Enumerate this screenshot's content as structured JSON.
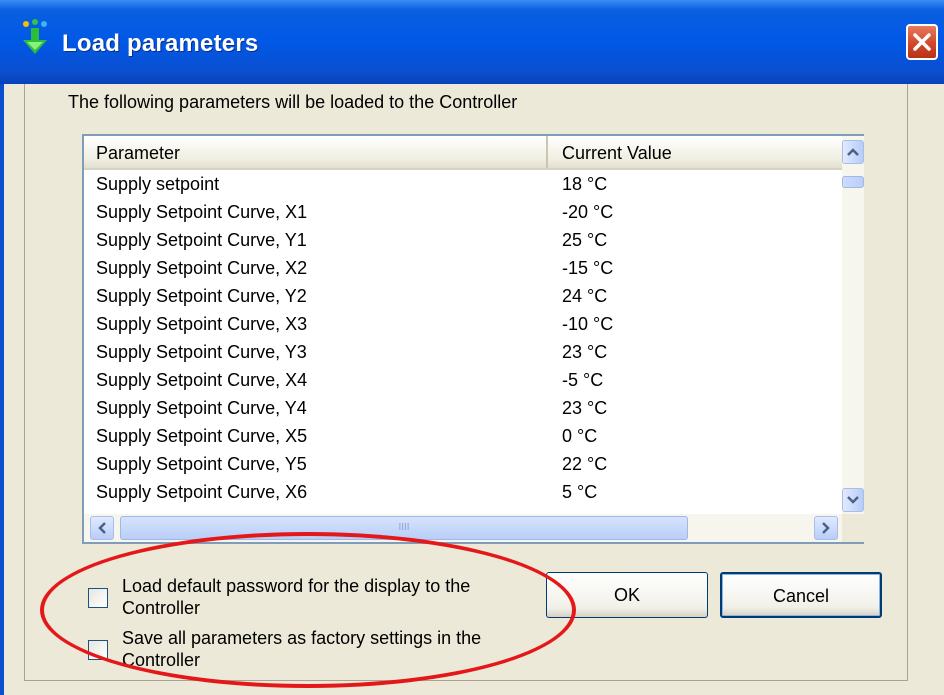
{
  "window": {
    "title": "Load parameters",
    "accent_color": "#0058e6",
    "close_color": "#d1482a"
  },
  "intro_text": "The following parameters will be loaded to the Controller",
  "table": {
    "columns": [
      "Parameter",
      "Current Value"
    ],
    "rows": [
      {
        "parameter": "Supply setpoint",
        "value": "18 °C"
      },
      {
        "parameter": "Supply Setpoint Curve, X1",
        "value": "-20 °C"
      },
      {
        "parameter": "Supply Setpoint Curve, Y1",
        "value": "25 °C"
      },
      {
        "parameter": "Supply Setpoint Curve, X2",
        "value": "-15 °C"
      },
      {
        "parameter": "Supply Setpoint Curve, Y2",
        "value": "24 °C"
      },
      {
        "parameter": "Supply Setpoint Curve, X3",
        "value": "-10 °C"
      },
      {
        "parameter": "Supply Setpoint Curve, Y3",
        "value": "23 °C"
      },
      {
        "parameter": "Supply Setpoint Curve, X4",
        "value": "-5 °C"
      },
      {
        "parameter": "Supply Setpoint Curve, Y4",
        "value": "23 °C"
      },
      {
        "parameter": "Supply Setpoint Curve, X5",
        "value": "0 °C"
      },
      {
        "parameter": "Supply Setpoint Curve, Y5",
        "value": "22 °C"
      },
      {
        "parameter": "Supply Setpoint Curve, X6",
        "value": "5 °C"
      }
    ]
  },
  "options": {
    "load_default_password": {
      "label": "Load default password for the display to the Controller",
      "checked": false
    },
    "save_factory_settings": {
      "label": "Save all parameters as factory settings in the Controller",
      "checked": false
    }
  },
  "buttons": {
    "ok": "OK",
    "cancel": "Cancel"
  },
  "annotation": {
    "color": "#e41818"
  },
  "icons": [
    "load-parameters-icon",
    "close-icon",
    "scroll-up-icon",
    "scroll-down-icon",
    "scroll-left-icon",
    "scroll-right-icon"
  ]
}
